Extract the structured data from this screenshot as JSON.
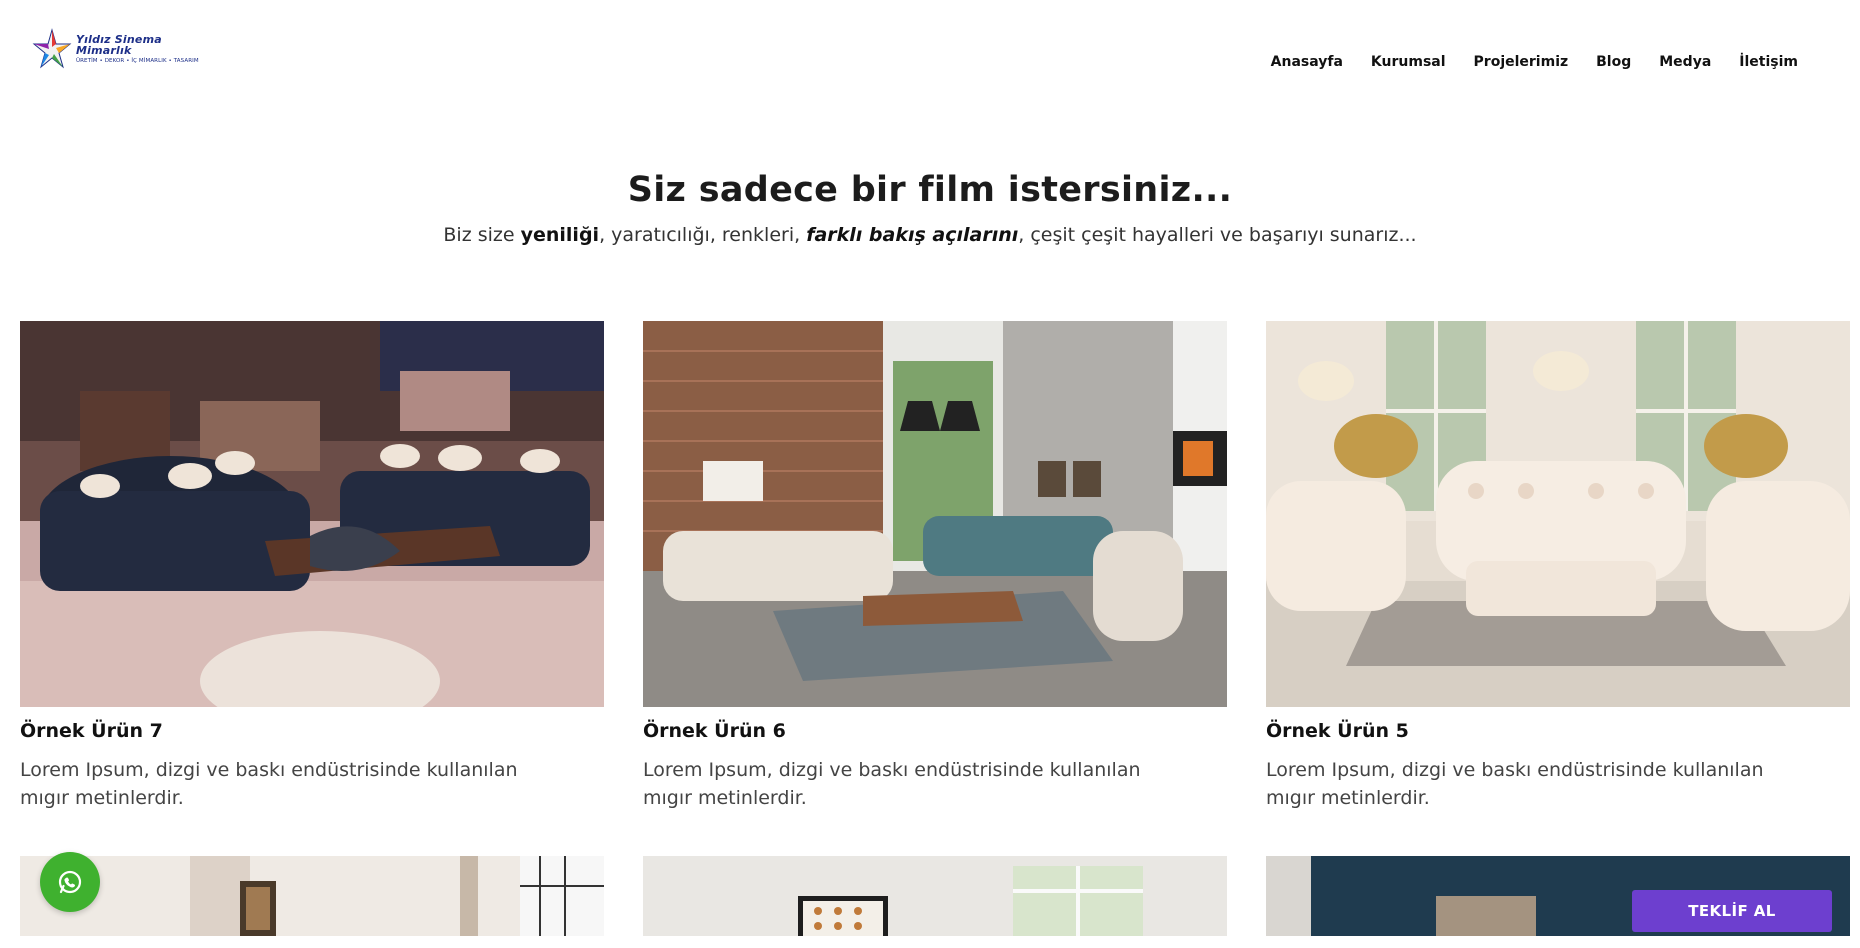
{
  "brand": {
    "name": "Yıldız Sinema Mimarlık",
    "tagline": "ÜRETİM • DEKOR • İÇ MİMARLIK • TASARIM"
  },
  "nav": {
    "items": [
      "Anasayfa",
      "Kurumsal",
      "Projelerimiz",
      "Blog",
      "Medya",
      "İletişim"
    ]
  },
  "hero": {
    "title": "Siz sadece bir film istersiniz...",
    "sub_1": "Biz size ",
    "sub_bold": "yeniliği",
    "sub_2": ", yaratıcılığı, renkleri, ",
    "sub_italic": "farklı bakış açılarını",
    "sub_3": ", çeşit çeşit hayalleri ve başarıyı sunarız..."
  },
  "products": [
    {
      "title": "Örnek Ürün 7",
      "description": "Lorem Ipsum, dizgi ve baskı endüstrisinde kullanılan mıgır metinlerdir."
    },
    {
      "title": "Örnek Ürün 6",
      "description": "Lorem Ipsum, dizgi ve baskı endüstrisinde kullanılan mıgır metinlerdir."
    },
    {
      "title": "Örnek Ürün 5",
      "description": "Lorem Ipsum, dizgi ve baskı endüstrisinde kullanılan mıgır metinlerdir."
    }
  ],
  "floating": {
    "quote_button": "TEKLİF AL",
    "whatsapp_icon": "whatsapp-icon"
  },
  "colors": {
    "brand_blue": "#1d2f88",
    "whatsapp_green": "#3fb12f",
    "cta_purple": "#6d3fcf"
  }
}
